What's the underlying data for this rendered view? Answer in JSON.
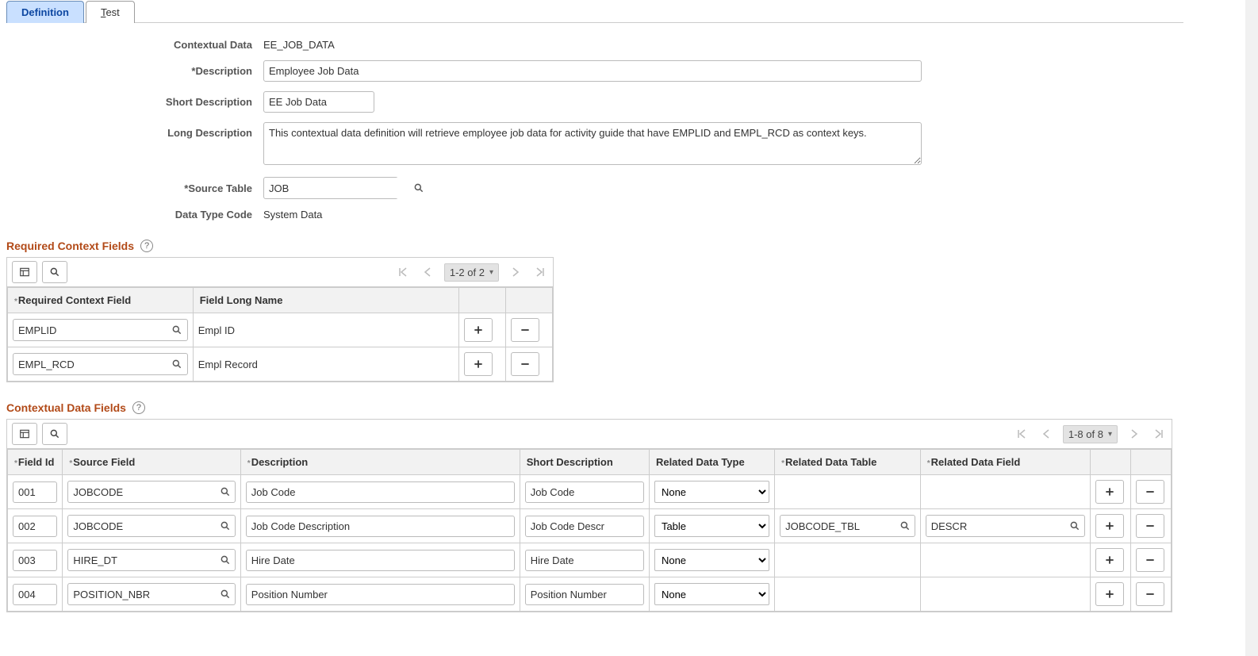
{
  "tabs": {
    "definition": "Definition",
    "test_prefix": "T",
    "test_rest": "est"
  },
  "header": {
    "contextual_data_label": "Contextual Data",
    "contextual_data_value": "EE_JOB_DATA",
    "description_label": "*Description",
    "description_value": "Employee Job Data",
    "short_description_label": "Short Description",
    "short_description_value": "EE Job Data",
    "long_description_label": "Long Description",
    "long_description_value": "This contextual data definition will retrieve employee job data for activity guide that have EMPLID and EMPL_RCD as context keys.",
    "source_table_label": "*Source Table",
    "source_table_value": "JOB",
    "data_type_code_label": "Data Type Code",
    "data_type_code_value": "System Data"
  },
  "section1": {
    "title": "Required Context Fields",
    "range": "1-2 of 2",
    "col_required": "Required Context Field",
    "col_longname": "Field Long Name",
    "rows": [
      {
        "field": "EMPLID",
        "longname": "Empl ID"
      },
      {
        "field": "EMPL_RCD",
        "longname": "Empl Record"
      }
    ]
  },
  "section2": {
    "title": "Contextual Data Fields",
    "range": "1-8 of 8",
    "cols": {
      "field_id": "Field Id",
      "source_field": "Source Field",
      "description": "Description",
      "short_description": "Short Description",
      "related_data_type": "Related Data Type",
      "related_data_table": "Related Data Table",
      "related_data_field": "Related Data Field"
    },
    "options": {
      "none": "None",
      "table": "Table"
    },
    "rows": [
      {
        "id": "001",
        "source": "JOBCODE",
        "desc": "Job Code",
        "short": "Job Code",
        "rtype": "None",
        "rtable": "",
        "rfield": ""
      },
      {
        "id": "002",
        "source": "JOBCODE",
        "desc": "Job Code Description",
        "short": "Job Code Descr",
        "rtype": "Table",
        "rtable": "JOBCODE_TBL",
        "rfield": "DESCR"
      },
      {
        "id": "003",
        "source": "HIRE_DT",
        "desc": "Hire Date",
        "short": "Hire Date",
        "rtype": "None",
        "rtable": "",
        "rfield": ""
      },
      {
        "id": "004",
        "source": "POSITION_NBR",
        "desc": "Position Number",
        "short": "Position Number",
        "rtype": "None",
        "rtable": "",
        "rfield": ""
      }
    ]
  }
}
